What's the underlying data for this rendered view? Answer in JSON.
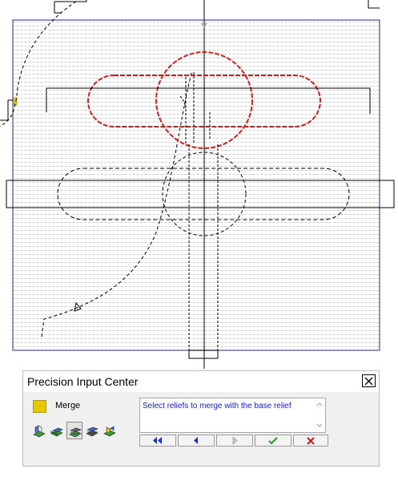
{
  "dialog": {
    "title": "Precision Input Center",
    "merge_label": "Merge",
    "prompt": "Select reliefs to merge with the base relief",
    "mode_icons": [
      "relief-add-icon",
      "relief-subtract-icon",
      "relief-merge-high-icon",
      "relief-merge-low-icon",
      "relief-multiply-icon"
    ],
    "selected_mode": "relief-merge-high-icon",
    "nav_buttons": [
      "first-step-button",
      "previous-step-button",
      "next-step-button",
      "apply-button",
      "cancel-button"
    ]
  },
  "colors": {
    "grid_dash": "#c8c8c8",
    "model_border": "#4c4c9c",
    "selected_relief": "#cc2222",
    "merge_swatch": "#e6c800",
    "prompt_text": "#1a1acc",
    "nav_arrow": "#1c2fd0",
    "apply_check": "#2a9a2a",
    "cancel_x": "#d01818"
  }
}
